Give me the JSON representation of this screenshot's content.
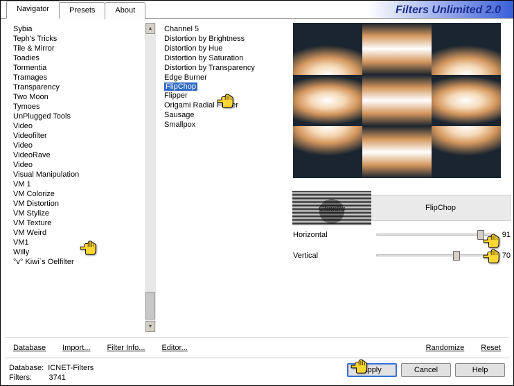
{
  "title": "Filters Unlimited 2.0",
  "tabs": [
    {
      "label": "Navigator",
      "active": true
    },
    {
      "label": "Presets",
      "active": false
    },
    {
      "label": "About",
      "active": false
    }
  ],
  "leftList": {
    "items": [
      "Sybia",
      "Teph's Tricks",
      "Tile & Mirror",
      "Toadies",
      "Tormentia",
      "Tramages",
      "Transparency",
      "Two Moon",
      "Tymoes",
      "UnPlugged Tools",
      "Video",
      "Videofilter",
      "Video",
      "VideoRave",
      "Video",
      "Visual Manipulation",
      "VM 1",
      "VM Colorize",
      "VM Distortion",
      "VM Stylize",
      "VM Texture",
      "VM Weird",
      "VM1",
      "Willy",
      "°v° Kiwi`s Oelfilter"
    ],
    "selectedIndex": 18
  },
  "midList": {
    "items": [
      "Channel 5",
      "Distortion by Brightness",
      "Distortion by Hue",
      "Distortion by Saturation",
      "Distortion by Transparency",
      "Edge Burner",
      "FlipChop",
      "Flipper",
      "Origami Radial Folder",
      "Sausage",
      "Smallpox"
    ],
    "selectedIndex": 6
  },
  "currentFilter": "FlipChop",
  "sliders": [
    {
      "label": "Horizontal",
      "value": 91,
      "pct": 91
    },
    {
      "label": "Vertical",
      "value": 70,
      "pct": 70
    }
  ],
  "toolbar": {
    "database": "Database",
    "import": "Import...",
    "filterInfo": "Filter Info...",
    "editor": "Editor...",
    "randomize": "Randomize",
    "reset": "Reset"
  },
  "footer": {
    "dbLabel": "Database:",
    "dbName": "ICNET-Filters",
    "filtersLabel": "Filters:",
    "filtersCount": "3741",
    "apply": "Apply",
    "cancel": "Cancel",
    "help": "Help"
  }
}
